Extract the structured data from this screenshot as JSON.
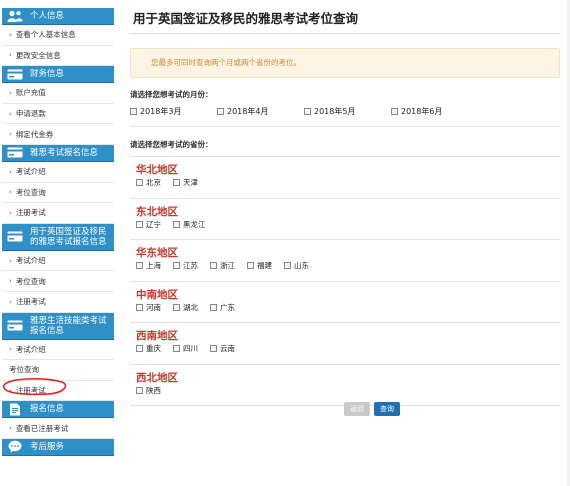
{
  "sidebar": [
    {
      "title": "个人信息",
      "icon": "user-icon",
      "items": [
        "查看个人基本信息",
        "更改安全信息"
      ]
    },
    {
      "title": "财务信息",
      "icon": "card-icon",
      "items": [
        "账户充值",
        "申请退款",
        "绑定代金券"
      ]
    },
    {
      "title": "雅思考试报名信息",
      "icon": "card-icon",
      "items": [
        "考试介绍",
        "考位查询",
        "注册考试"
      ]
    },
    {
      "title": "用于英国签证及移民的雅思考试报名信息",
      "icon": "card-icon",
      "items": [
        "考试介绍",
        "考位查询",
        "注册考试"
      ]
    },
    {
      "title": "雅思生活技能类考试报名信息",
      "icon": "card-icon",
      "items": [
        "考试介绍",
        "考位查询",
        "注册考试"
      ]
    },
    {
      "title": "报名信息",
      "icon": "document-icon",
      "items": [
        "查看已注册考试"
      ]
    },
    {
      "title": "考后服务",
      "icon": "chat-icon",
      "items": []
    }
  ],
  "main": {
    "title": "用于英国签证及移民的雅思考试考位查询",
    "notice": "您最多可同时查询两个月或两个省份的考位。",
    "month_label": "请选择您想考试的月份：",
    "months": [
      "2018年3月",
      "2018年4月",
      "2018年5月",
      "2018年6月"
    ],
    "province_label": "请选择您想考试的省份：",
    "regions": [
      {
        "name": "华北地区",
        "provinces": [
          "北京",
          "天津"
        ]
      },
      {
        "name": "东北地区",
        "provinces": [
          "辽宁",
          "黑龙江"
        ]
      },
      {
        "name": "华东地区",
        "provinces": [
          "上海",
          "江苏",
          "浙江",
          "福建",
          "山东"
        ]
      },
      {
        "name": "中南地区",
        "provinces": [
          "河南",
          "湖北",
          "广东"
        ]
      },
      {
        "name": "西南地区",
        "provinces": [
          "重庆",
          "四川",
          "云南"
        ]
      },
      {
        "name": "西北地区",
        "provinces": [
          "陕西"
        ]
      }
    ],
    "back_label": "返回",
    "query_label": "查询"
  },
  "colors": {
    "accent": "#2f8fc7",
    "region": "#c0392b",
    "notice_bg": "#fdf4e3",
    "annotation": "#e0241b"
  }
}
